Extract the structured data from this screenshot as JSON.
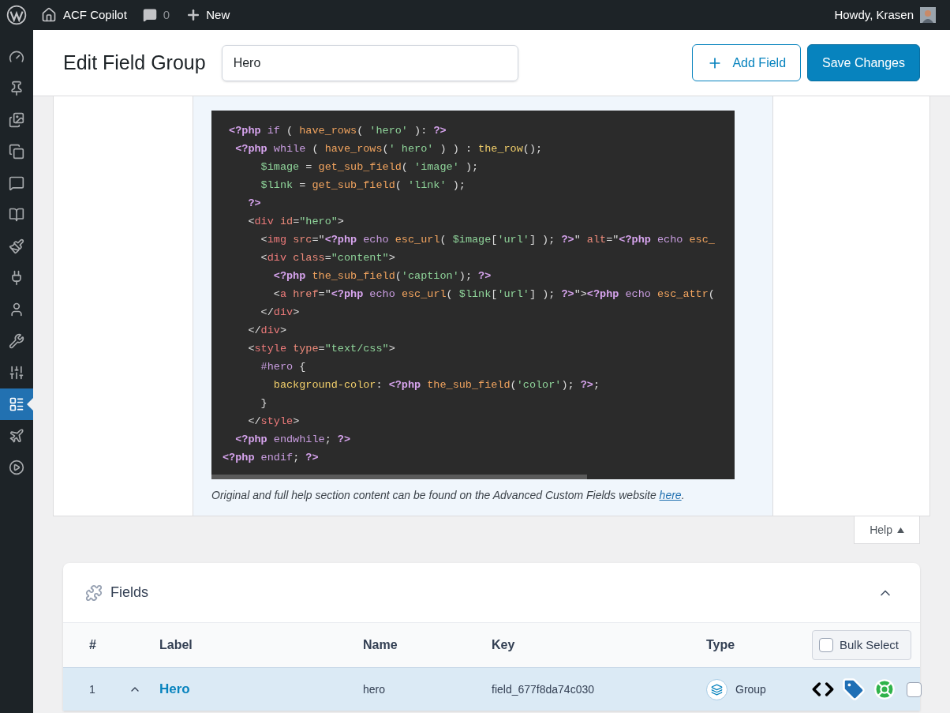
{
  "admin_bar": {
    "site": "ACF Copilot",
    "comments": "0",
    "new": "New",
    "greeting": "Howdy, Krasen"
  },
  "sidebar": {
    "items": [
      {
        "kind": "dashboard",
        "selected": false
      },
      {
        "kind": "pin",
        "selected": false
      },
      {
        "kind": "media",
        "selected": false
      },
      {
        "kind": "pages",
        "selected": false
      },
      {
        "kind": "comments",
        "selected": false
      },
      {
        "kind": "book",
        "selected": false
      },
      {
        "kind": "brush",
        "selected": false
      },
      {
        "kind": "plug",
        "selected": false
      },
      {
        "kind": "user",
        "selected": false
      },
      {
        "kind": "wrench",
        "selected": false
      },
      {
        "kind": "sliders",
        "selected": false
      },
      {
        "kind": "table",
        "selected": true
      },
      {
        "kind": "plane",
        "selected": false
      },
      {
        "kind": "play",
        "selected": false
      }
    ]
  },
  "header": {
    "title": "Edit Field Group",
    "group_name": "Hero",
    "buttons": [
      {
        "label": "Add Field",
        "kind": "secondary"
      },
      {
        "label": "Save Changes",
        "kind": "primary"
      }
    ]
  },
  "help": {
    "code": [
      [
        {
          "kind": "php",
          "text": " <?php"
        },
        {
          "kind": "kw",
          "text": " if"
        },
        {
          "kind": "p",
          "text": " ( "
        },
        {
          "kind": "fn",
          "text": "have_rows"
        },
        {
          "kind": "p",
          "text": "( "
        },
        {
          "kind": "str",
          "text": "'hero'"
        },
        {
          "kind": "p",
          "text": " ): "
        },
        {
          "kind": "php",
          "text": "?>"
        }
      ],
      [
        {
          "kind": "php",
          "text": "  <?php"
        },
        {
          "kind": "kw",
          "text": " while"
        },
        {
          "kind": "p",
          "text": " ( "
        },
        {
          "kind": "fn",
          "text": "have_rows"
        },
        {
          "kind": "p",
          "text": "("
        },
        {
          "kind": "str",
          "text": "' hero'"
        },
        {
          "kind": "p",
          "text": " ) ) : "
        },
        {
          "kind": "fn2",
          "text": "the_row"
        },
        {
          "kind": "p",
          "text": "();"
        }
      ],
      [
        {
          "kind": "var",
          "text": "      $image"
        },
        {
          "kind": "p",
          "text": " = "
        },
        {
          "kind": "fn",
          "text": "get_sub_field"
        },
        {
          "kind": "p",
          "text": "( "
        },
        {
          "kind": "str",
          "text": "'image'"
        },
        {
          "kind": "p",
          "text": " );"
        }
      ],
      [
        {
          "kind": "var",
          "text": "      $link"
        },
        {
          "kind": "p",
          "text": " = "
        },
        {
          "kind": "fn",
          "text": "get_sub_field"
        },
        {
          "kind": "p",
          "text": "( "
        },
        {
          "kind": "str",
          "text": "'link'"
        },
        {
          "kind": "p",
          "text": " );"
        }
      ],
      [
        {
          "kind": "php",
          "text": "    ?>"
        }
      ],
      [
        {
          "kind": "p",
          "text": "    <"
        },
        {
          "kind": "tag",
          "text": "div"
        },
        {
          "kind": "attr",
          "text": " id"
        },
        {
          "kind": "p",
          "text": "="
        },
        {
          "kind": "str",
          "text": "\"hero\""
        },
        {
          "kind": "p",
          "text": ">"
        }
      ],
      [
        {
          "kind": "p",
          "text": "      <"
        },
        {
          "kind": "tag",
          "text": "img"
        },
        {
          "kind": "attr",
          "text": " src"
        },
        {
          "kind": "p",
          "text": "=\""
        },
        {
          "kind": "php",
          "text": "<?php"
        },
        {
          "kind": "kw",
          "text": " echo"
        },
        {
          "kind": "fn",
          "text": " esc_url"
        },
        {
          "kind": "p",
          "text": "( "
        },
        {
          "kind": "var",
          "text": "$image"
        },
        {
          "kind": "p",
          "text": "["
        },
        {
          "kind": "str",
          "text": "'url'"
        },
        {
          "kind": "p",
          "text": "] ); "
        },
        {
          "kind": "php",
          "text": "?>"
        },
        {
          "kind": "p",
          "text": "\""
        },
        {
          "kind": "attr",
          "text": " alt"
        },
        {
          "kind": "p",
          "text": "=\""
        },
        {
          "kind": "php",
          "text": "<?php"
        },
        {
          "kind": "kw",
          "text": " echo"
        },
        {
          "kind": "fn",
          "text": " esc_"
        }
      ],
      [
        {
          "kind": "p",
          "text": "      <"
        },
        {
          "kind": "tag",
          "text": "div"
        },
        {
          "kind": "attr",
          "text": " class"
        },
        {
          "kind": "p",
          "text": "="
        },
        {
          "kind": "str",
          "text": "\"content\""
        },
        {
          "kind": "p",
          "text": ">"
        }
      ],
      [
        {
          "kind": "php",
          "text": "        <?php"
        },
        {
          "kind": "fn",
          "text": " the_sub_field"
        },
        {
          "kind": "p",
          "text": "("
        },
        {
          "kind": "str",
          "text": "'caption'"
        },
        {
          "kind": "p",
          "text": "); "
        },
        {
          "kind": "php",
          "text": "?>"
        }
      ],
      [
        {
          "kind": "p",
          "text": "        <"
        },
        {
          "kind": "tag",
          "text": "a"
        },
        {
          "kind": "attr",
          "text": " href"
        },
        {
          "kind": "p",
          "text": "=\""
        },
        {
          "kind": "php",
          "text": "<?php"
        },
        {
          "kind": "kw",
          "text": " echo"
        },
        {
          "kind": "fn",
          "text": " esc_url"
        },
        {
          "kind": "p",
          "text": "( "
        },
        {
          "kind": "var",
          "text": "$link"
        },
        {
          "kind": "p",
          "text": "["
        },
        {
          "kind": "str",
          "text": "'url'"
        },
        {
          "kind": "p",
          "text": "] ); "
        },
        {
          "kind": "php",
          "text": "?>"
        },
        {
          "kind": "p",
          "text": "\">"
        },
        {
          "kind": "php",
          "text": "<?php"
        },
        {
          "kind": "kw",
          "text": " echo"
        },
        {
          "kind": "fn",
          "text": " esc_attr"
        },
        {
          "kind": "p",
          "text": "("
        }
      ],
      [
        {
          "kind": "p",
          "text": "      </"
        },
        {
          "kind": "tag",
          "text": "div"
        },
        {
          "kind": "p",
          "text": ">"
        }
      ],
      [
        {
          "kind": "p",
          "text": "    </"
        },
        {
          "kind": "tag",
          "text": "div"
        },
        {
          "kind": "p",
          "text": ">"
        }
      ],
      [
        {
          "kind": "p",
          "text": "    <"
        },
        {
          "kind": "tag",
          "text": "style"
        },
        {
          "kind": "attr",
          "text": " type"
        },
        {
          "kind": "p",
          "text": "="
        },
        {
          "kind": "str",
          "text": "\"text/css\""
        },
        {
          "kind": "p",
          "text": ">"
        }
      ],
      [
        {
          "kind": "kw",
          "text": "      #hero"
        },
        {
          "kind": "p",
          "text": " {"
        }
      ],
      [
        {
          "kind": "fn2",
          "text": "        background-color"
        },
        {
          "kind": "p",
          "text": ": "
        },
        {
          "kind": "php",
          "text": "<?php"
        },
        {
          "kind": "fn",
          "text": " the_sub_field"
        },
        {
          "kind": "p",
          "text": "("
        },
        {
          "kind": "str",
          "text": "'color'"
        },
        {
          "kind": "p",
          "text": "); "
        },
        {
          "kind": "php",
          "text": "?>"
        },
        {
          "kind": "p",
          "text": ";"
        }
      ],
      [
        {
          "kind": "p",
          "text": "      }"
        }
      ],
      [
        {
          "kind": "p",
          "text": "    </"
        },
        {
          "kind": "tag",
          "text": "style"
        },
        {
          "kind": "p",
          "text": ">"
        }
      ],
      [
        {
          "kind": "php",
          "text": "  <?php"
        },
        {
          "kind": "kw",
          "text": " endwhile"
        },
        {
          "kind": "p",
          "text": "; "
        },
        {
          "kind": "php",
          "text": "?>"
        }
      ],
      [
        {
          "kind": "php",
          "text": "<?php"
        },
        {
          "kind": "kw",
          "text": " endif"
        },
        {
          "kind": "p",
          "text": "; "
        },
        {
          "kind": "php",
          "text": "?>"
        }
      ]
    ],
    "footnote": "Original and full help section content can be found on the Advanced Custom Fields website",
    "link": "here",
    "footnote_end": ".",
    "tab": "Help",
    "expanded": true
  },
  "fields": {
    "title": "Fields",
    "expanded": true,
    "columns": [
      "#",
      "Label",
      "Name",
      "Key",
      "Type"
    ],
    "bulk_select": {
      "label": "Bulk Select",
      "checked": false
    },
    "rows": [
      {
        "number": "1",
        "label": "Hero",
        "name": "hero",
        "key": "field_677f8da74c030",
        "type": "Group",
        "expanded": true,
        "selected": true,
        "checked": false
      }
    ]
  }
}
